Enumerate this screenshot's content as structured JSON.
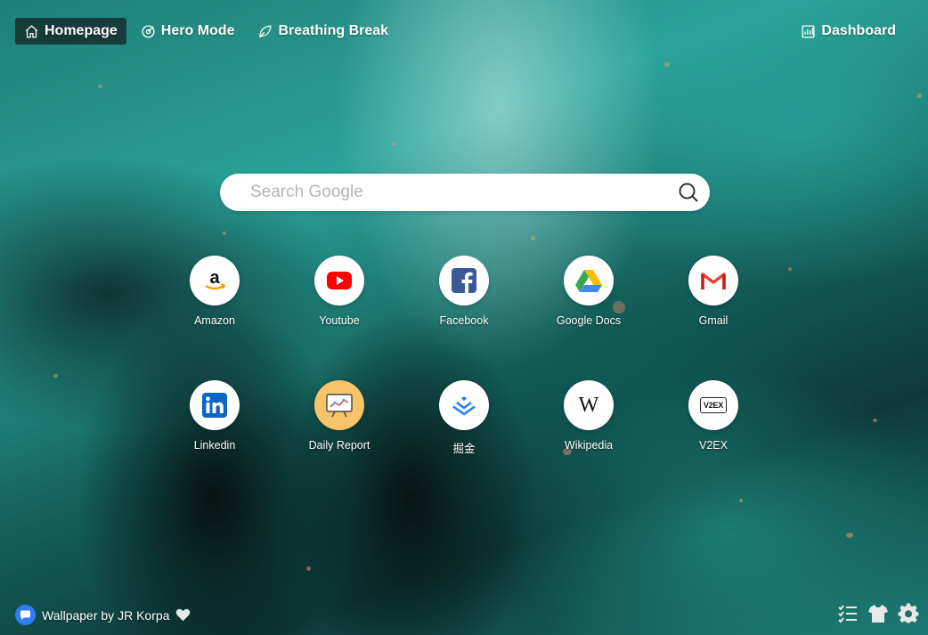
{
  "nav": {
    "tabs": [
      {
        "label": "Homepage",
        "icon": "home-icon",
        "active": true
      },
      {
        "label": "Hero Mode",
        "icon": "target-icon",
        "active": false
      },
      {
        "label": "Breathing Break",
        "icon": "leaf-icon",
        "active": false
      }
    ],
    "dashboard_label": "Dashboard",
    "dashboard_icon": "bar-chart-icon"
  },
  "search": {
    "placeholder": "Search Google",
    "value": "",
    "icon": "search-icon"
  },
  "shortcuts": [
    {
      "label": "Amazon",
      "icon": "amazon-icon"
    },
    {
      "label": "Youtube",
      "icon": "youtube-icon"
    },
    {
      "label": "Facebook",
      "icon": "facebook-icon"
    },
    {
      "label": "Google Docs",
      "icon": "google-drive-icon"
    },
    {
      "label": "Gmail",
      "icon": "gmail-icon"
    },
    {
      "label": "Linkedin",
      "icon": "linkedin-icon"
    },
    {
      "label": "Daily Report",
      "icon": "daily-report-icon"
    },
    {
      "label": "掘金",
      "icon": "juejin-icon"
    },
    {
      "label": "Wikipedia",
      "icon": "wikipedia-icon",
      "logo_text": "W"
    },
    {
      "label": "V2EX",
      "icon": "v2ex-icon",
      "logo_text": "V2EX"
    }
  ],
  "footer": {
    "credit": "Wallpaper by JR Korpa",
    "credit_icon": "chat-bubble-icon",
    "like_icon": "heart-icon",
    "tools": [
      "checklist-icon",
      "tshirt-icon",
      "gear-icon"
    ]
  },
  "colors": {
    "accent_blue": "#2f7df6",
    "youtube_red": "#ff0000",
    "facebook_blue": "#3b5998",
    "linkedin_blue": "#0a66c2",
    "juejin_blue": "#1e80ff"
  }
}
